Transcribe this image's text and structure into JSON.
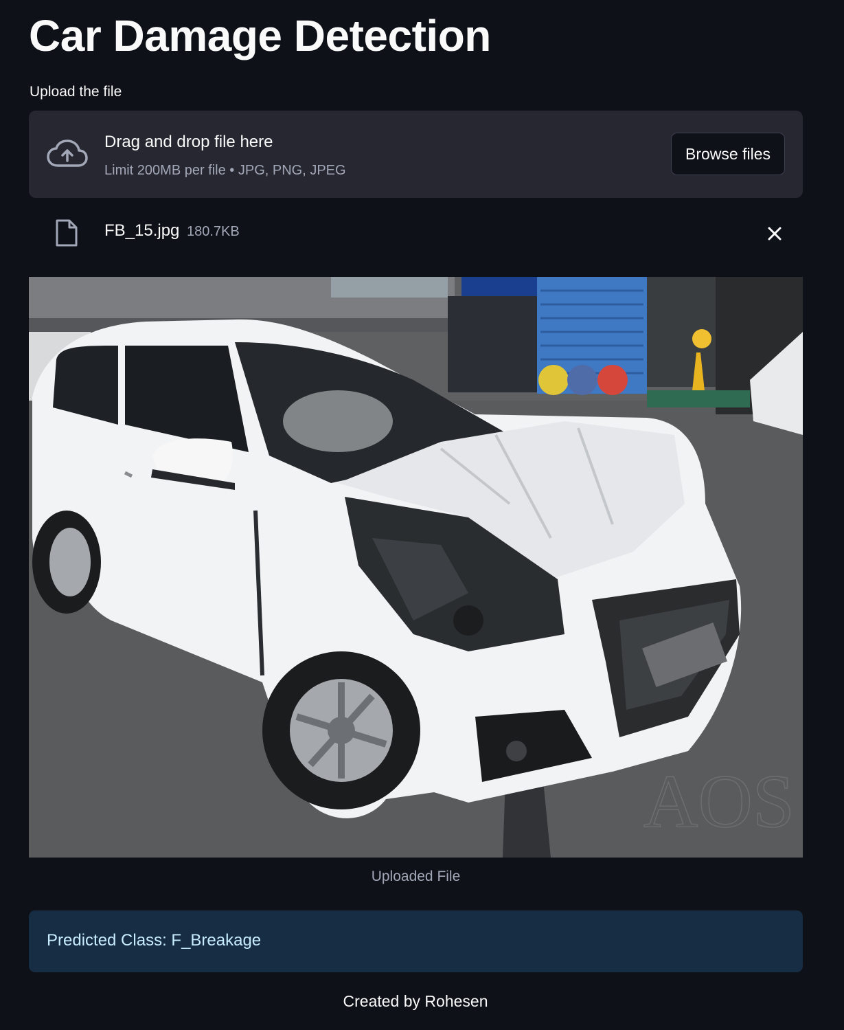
{
  "page": {
    "title": "Car Damage Detection"
  },
  "uploader": {
    "label": "Upload the file",
    "drop_title": "Drag and drop file here",
    "drop_subtitle": "Limit 200MB per file • JPG, PNG, JPEG",
    "browse_label": "Browse files",
    "icon": "cloud-upload-icon"
  },
  "file": {
    "name": "FB_15.jpg",
    "size": "180.7KB",
    "icon": "file-icon",
    "remove_icon": "close-icon"
  },
  "image": {
    "caption": "Uploaded File",
    "sign_text": "AOS"
  },
  "result": {
    "text": "Predicted Class: F_Breakage",
    "color": "#172d43"
  },
  "footer": {
    "text": "Created by Rohesen"
  },
  "colors": {
    "background": "#0e1117",
    "dropzone": "#262730",
    "muted_text": "#a3a8b8",
    "info_text": "#c7ebff"
  }
}
